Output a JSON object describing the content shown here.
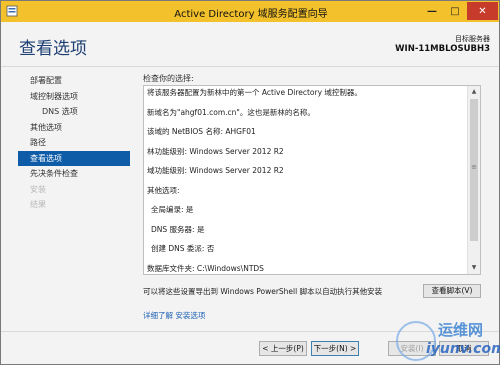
{
  "window": {
    "title": "Active Directory 域服务配置向导",
    "minimize": "—",
    "maximize": "□",
    "close": "✕"
  },
  "header": {
    "page_title": "查看选项",
    "target_label": "目标服务器",
    "target_name": "WIN-11MBLOSUBH3"
  },
  "nav": {
    "items": [
      {
        "label": "部署配置"
      },
      {
        "label": "域控制器选项"
      },
      {
        "label": "DNS 选项"
      },
      {
        "label": "其他选项"
      },
      {
        "label": "路径"
      },
      {
        "label": "查看选项"
      },
      {
        "label": "先决条件检查"
      },
      {
        "label": "安装"
      },
      {
        "label": "结果"
      }
    ]
  },
  "main": {
    "section_label": "检查你的选择:",
    "summary_lines": [
      "将该服务器配置为新林中的第一个 Active Directory 域控制器。",
      "新域名为\"ahgf01.com.cn\"。这也是新林的名称。",
      "该域的 NetBIOS 名称: AHGF01",
      "林功能级别: Windows Server 2012 R2",
      "域功能级别: Windows Server 2012 R2",
      "其他选项:",
      "全局编录: 是",
      "DNS 服务器: 是",
      "创建 DNS 委派: 否",
      "数据库文件夹: C:\\Windows\\NTDS"
    ],
    "export_text": "可以将这些设置导出到 Windows PowerShell 脚本以自动执行其他安装",
    "view_script_label": "查看脚本(V)",
    "more_link": "详细了解 安装选项"
  },
  "footer": {
    "prev_label": "< 上一步(P)",
    "next_label": "下一步(N) >",
    "install_label": "安装(I)",
    "cancel_label": "取消"
  },
  "watermark": {
    "line1": "运维网",
    "line2": "iyunv.com"
  },
  "colors": {
    "titlebar": "#f3c12c",
    "accent": "#0e5ca8",
    "title_text": "#1e3f73",
    "link": "#1a5fb4",
    "close": "#c63b2a"
  }
}
